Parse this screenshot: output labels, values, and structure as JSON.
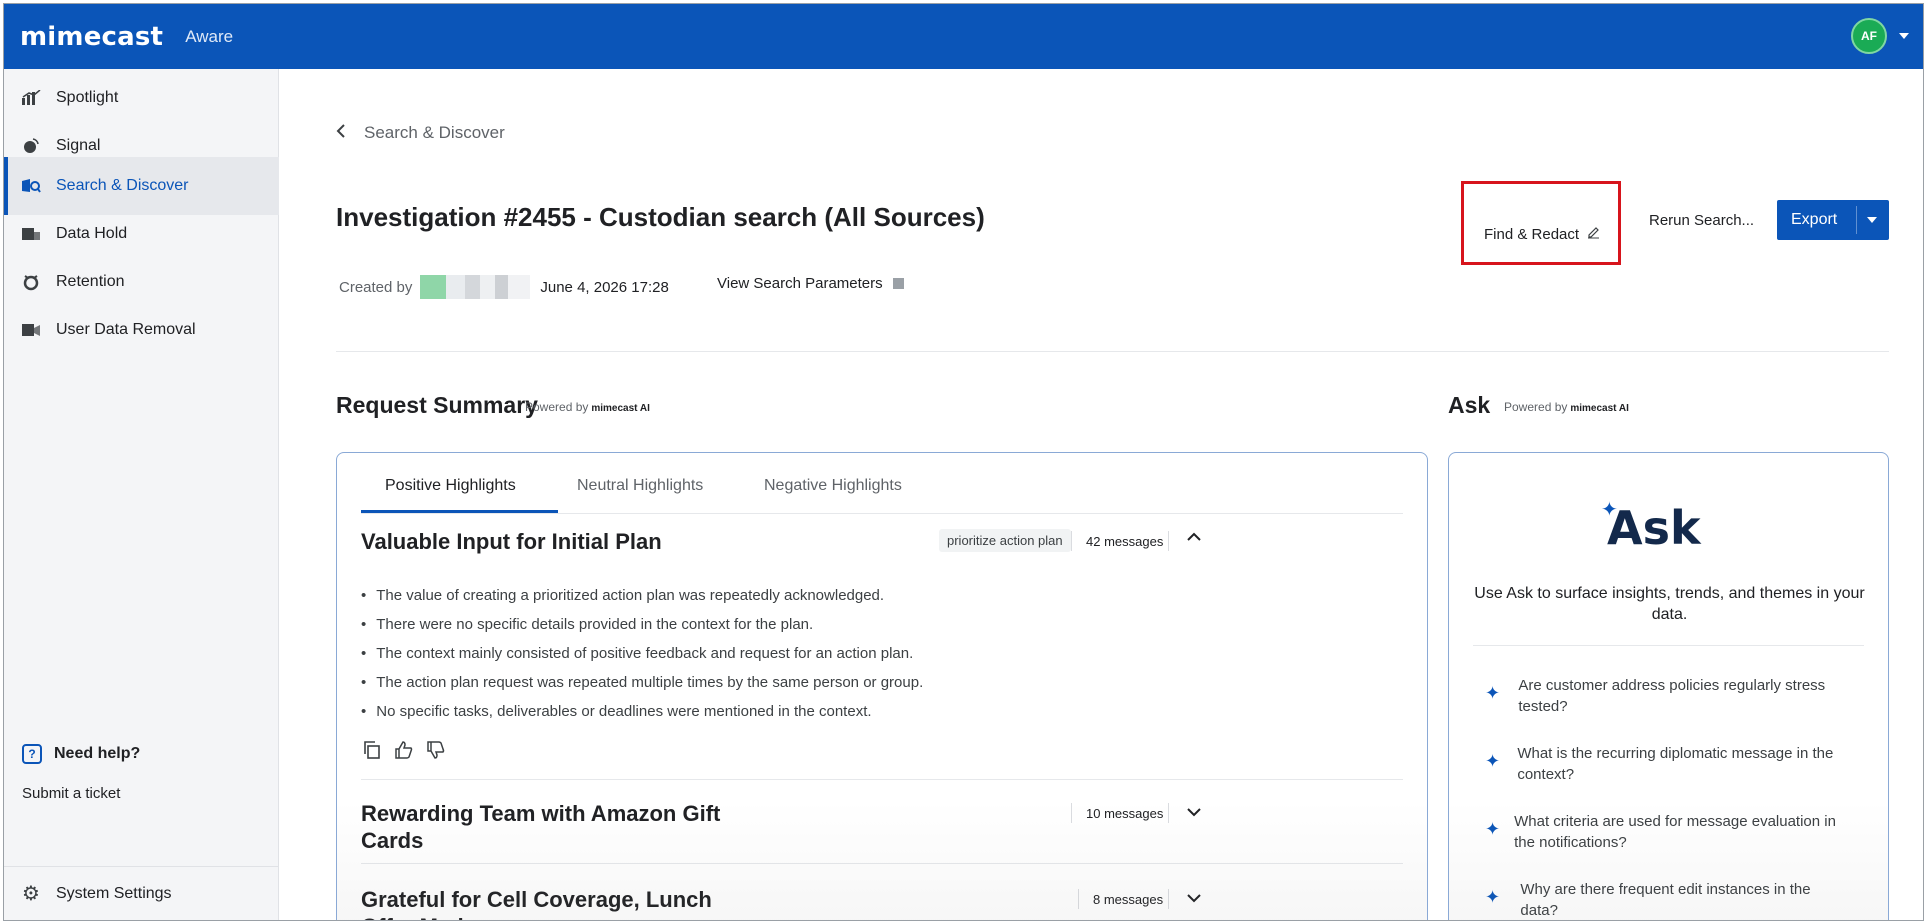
{
  "header": {
    "logo": "mimecast",
    "product": "Aware",
    "avatar_initials": "AF"
  },
  "sidebar": {
    "items": [
      {
        "label": "Spotlight",
        "icon": "bar-chart-icon"
      },
      {
        "label": "Signal",
        "icon": "signal-icon"
      },
      {
        "label": "Search & Discover",
        "icon": "search-discover-icon",
        "active": true
      },
      {
        "label": "Data Hold",
        "icon": "data-hold-icon"
      },
      {
        "label": "Retention",
        "icon": "retention-icon"
      },
      {
        "label": "User Data Removal",
        "icon": "user-data-removal-icon"
      }
    ],
    "help_label": "Need help?",
    "help_icon": "?",
    "ticket_label": "Submit a ticket",
    "settings_label": "System Settings"
  },
  "main": {
    "breadcrumb": "Search & Discover",
    "title": "Investigation #2455 - Custodian search (All Sources)",
    "created_by_label": "Created by",
    "created_date": "June 4, 2026 17:28",
    "view_params_label": "View Search Parameters",
    "buttons": {
      "find_redact": "Find & Redact",
      "rerun": "Rerun Search...",
      "export": "Export"
    },
    "summary": {
      "title": "Request Summary",
      "powered_by": "Powered by",
      "powered_brand": "mimecast AI",
      "tabs": [
        "Positive Highlights",
        "Neutral Highlights",
        "Negative Highlights"
      ],
      "rows": [
        {
          "title": "Valuable Input for Initial Plan",
          "tag": "prioritize action plan",
          "messages": "42 messages",
          "bullets": [
            "The value of creating a prioritized action plan was repeatedly acknowledged.",
            "There were no specific details provided in the context for the plan.",
            "The context mainly consisted of positive feedback and request for an action plan.",
            "The action plan request was repeated multiple times by the same person or group.",
            "No specific tasks, deliverables or deadlines were mentioned in the context."
          ]
        },
        {
          "title_line1": "Rewarding Team with Amazon Gift",
          "title_line2": "Cards",
          "messages": "10 messages"
        },
        {
          "title_line1": "Grateful for Cell Coverage, Lunch",
          "title_line2": "Offer Made",
          "messages": "8 messages"
        }
      ]
    },
    "ask": {
      "title": "Ask",
      "powered_by": "Powered by",
      "powered_brand": "mimecast AI",
      "logo_text": "Ask",
      "description": "Use Ask to surface insights, trends, and themes in your data.",
      "suggestions": [
        "Are customer address policies regularly stress tested?",
        "What is the recurring diplomatic message in the context?",
        "What criteria are used for message evaluation in the notifications?",
        "Why are there frequent edit instances in the data?"
      ]
    }
  },
  "colors": {
    "brand": "#0b55b8",
    "highlight_box": "#d7141c",
    "avatar": "#1aab55"
  }
}
